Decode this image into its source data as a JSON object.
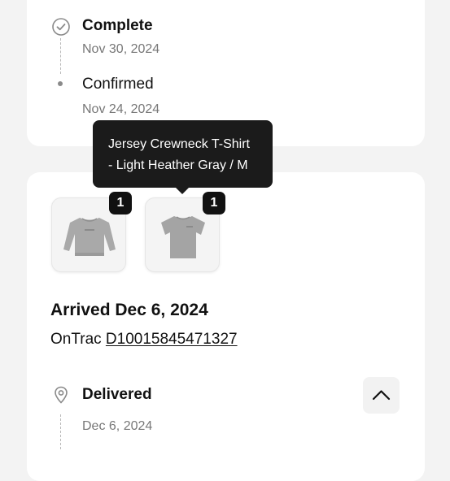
{
  "timeline_top": {
    "steps": [
      {
        "title": "Complete",
        "date": "Nov 30, 2024",
        "icon": "check-circle-icon"
      },
      {
        "title": "Confirmed",
        "date": "Nov 24, 2024",
        "icon": "dot-icon"
      }
    ]
  },
  "shipment": {
    "items": [
      {
        "kind": "sweatshirt",
        "quantity": "1",
        "color": "#a9a9a9"
      },
      {
        "kind": "t-shirt",
        "quantity": "1",
        "color": "#a4a4a4"
      }
    ],
    "tooltip": {
      "line1": "Jersey Crewneck T-Shirt",
      "line2": "- Light Heather Gray / M"
    },
    "arrived": "Arrived Dec 6, 2024",
    "carrier": "OnTrac",
    "tracking_number": "D10015845471327",
    "timeline": [
      {
        "title": "Delivered",
        "date": "Dec 6, 2024",
        "icon": "location-pin-icon"
      }
    ],
    "collapse_icon": "chevron-up-icon"
  },
  "colors": {
    "background": "#f3f3f3",
    "card": "#ffffff",
    "badge": "#111111",
    "tooltip": "#1b1b1b",
    "muted_text": "#777777"
  }
}
